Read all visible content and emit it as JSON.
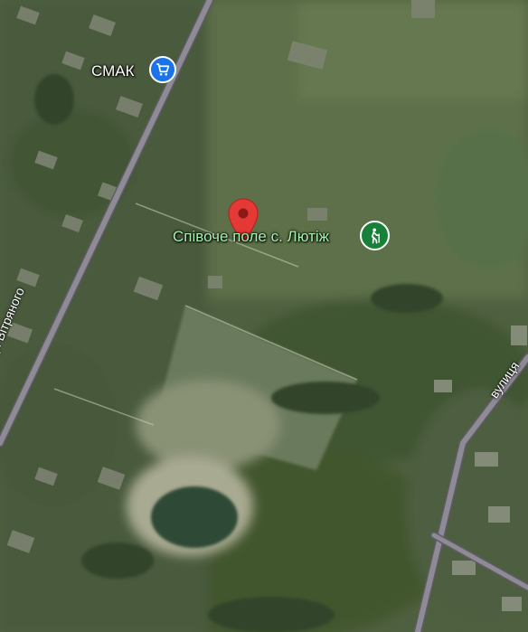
{
  "map": {
    "view": "satellite",
    "colors": {
      "road": "#8e8a96",
      "road_edge": "#5f5c66",
      "shop_marker": "#1a73e8",
      "park_marker": "#188038",
      "pin": "#e53935",
      "pin_dot": "#8b1a14"
    }
  },
  "labels": {
    "shop": "СМАК",
    "place": "Співоче поле с. Лютіж",
    "street_left": "вулиця Вітряного",
    "street_right": "вулиця"
  },
  "icons": {
    "shop": "shopping-cart-icon",
    "place": "hiking-icon",
    "pin": "map-pin-icon"
  }
}
